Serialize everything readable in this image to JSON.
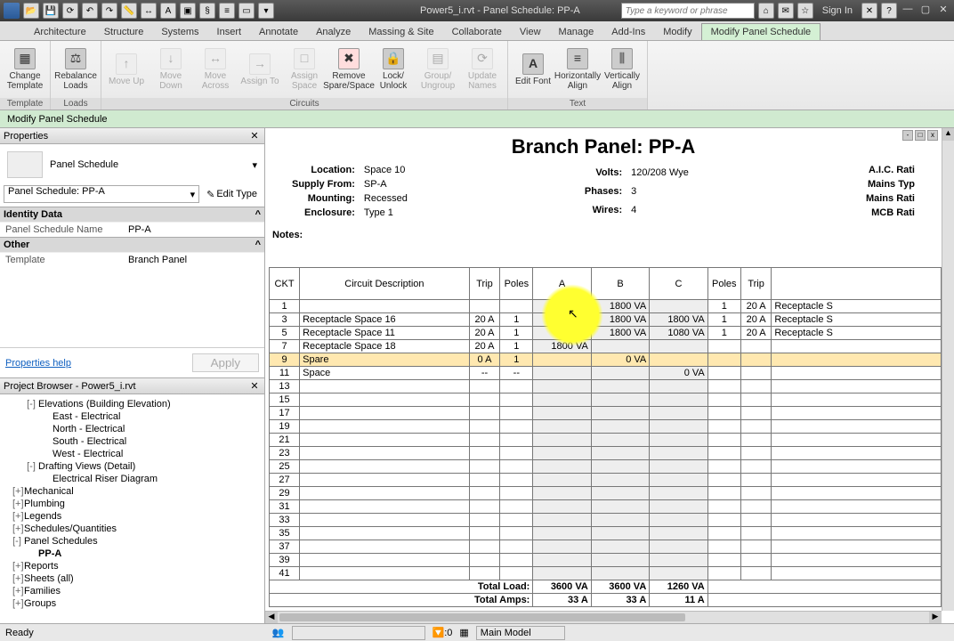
{
  "app": {
    "title": "Power5_i.rvt - Panel Schedule: PP-A",
    "search_placeholder": "Type a keyword or phrase",
    "signin": "Sign In"
  },
  "ribbon_tabs": [
    "Architecture",
    "Structure",
    "Systems",
    "Insert",
    "Annotate",
    "Analyze",
    "Massing & Site",
    "Collaborate",
    "View",
    "Manage",
    "Add-Ins",
    "Modify",
    "Modify Panel Schedule"
  ],
  "ribbon_active_tab": "Modify Panel Schedule",
  "ribbon": {
    "template_group_label": "Template",
    "loads_group_label": "Loads",
    "circuits_group_label": "Circuits",
    "text_group_label": "Text",
    "change_template": "Change Template",
    "rebalance_loads": "Rebalance Loads",
    "move_up": "Move Up",
    "move_down": "Move Down",
    "move_across": "Move Across",
    "assign_to": "Assign To",
    "assign_space": "Assign Space",
    "remove_sparespace": "Remove Spare/Space",
    "lock_unlock": "Lock/ Unlock",
    "group_ungroup": "Group/ Ungroup",
    "update_names": "Update Names",
    "edit_font": "Edit Font",
    "h_align": "Horizontally Align",
    "v_align": "Vertically Align"
  },
  "viewbar": {
    "label": "Modify Panel Schedule"
  },
  "properties": {
    "title": "Properties",
    "type_name": "Panel Schedule",
    "instance_combo": "Panel Schedule: PP-A",
    "edit_type": "Edit Type",
    "identity_data_hdr": "Identity Data",
    "panel_schedule_name_k": "Panel Schedule Name",
    "panel_schedule_name_v": "PP-A",
    "other_hdr": "Other",
    "template_k": "Template",
    "template_v": "Branch Panel",
    "help": "Properties help",
    "apply": "Apply"
  },
  "project_browser": {
    "title": "Project Browser - Power5_i.rvt",
    "nodes": [
      {
        "indent": 1,
        "exp": "-",
        "label": "Elevations (Building Elevation)"
      },
      {
        "indent": 2,
        "exp": "",
        "label": "East - Electrical"
      },
      {
        "indent": 2,
        "exp": "",
        "label": "North - Electrical"
      },
      {
        "indent": 2,
        "exp": "",
        "label": "South - Electrical"
      },
      {
        "indent": 2,
        "exp": "",
        "label": "West - Electrical"
      },
      {
        "indent": 1,
        "exp": "-",
        "label": "Drafting Views (Detail)"
      },
      {
        "indent": 2,
        "exp": "",
        "label": "Electrical Riser Diagram"
      },
      {
        "indent": 0,
        "exp": "+",
        "label": "Mechanical"
      },
      {
        "indent": 0,
        "exp": "+",
        "label": "Plumbing"
      },
      {
        "indent": 0,
        "exp": "+",
        "label": "Legends"
      },
      {
        "indent": 0,
        "exp": "+",
        "label": "Schedules/Quantities"
      },
      {
        "indent": 0,
        "exp": "-",
        "label": "Panel Schedules"
      },
      {
        "indent": 1,
        "exp": "",
        "label": "PP-A",
        "sel": true
      },
      {
        "indent": 0,
        "exp": "+",
        "label": "Reports"
      },
      {
        "indent": 0,
        "exp": "+",
        "label": "Sheets (all)"
      },
      {
        "indent": 0,
        "exp": "+",
        "label": "Families"
      },
      {
        "indent": 0,
        "exp": "+",
        "label": "Groups"
      }
    ]
  },
  "panel": {
    "title": "Branch Panel: PP-A",
    "location_k": "Location:",
    "location_v": "Space 10",
    "supply_k": "Supply From:",
    "supply_v": "SP-A",
    "mounting_k": "Mounting:",
    "mounting_v": "Recessed",
    "enclosure_k": "Enclosure:",
    "enclosure_v": "Type 1",
    "volts_k": "Volts:",
    "volts_v": "120/208 Wye",
    "phases_k": "Phases:",
    "phases_v": "3",
    "wires_k": "Wires:",
    "wires_v": "4",
    "aic_k": "A.I.C. Rati",
    "mains_type_k": "Mains Typ",
    "mains_rating_k": "Mains Rati",
    "mcb_k": "MCB Rati",
    "notes": "Notes:",
    "headers": {
      "ckt": "CKT",
      "desc": "Circuit Description",
      "trip": "Trip",
      "poles": "Poles",
      "a": "A",
      "b": "B",
      "c": "C",
      "poles2": "Poles",
      "trip2": "Trip",
      "desc2": ""
    },
    "rows": [
      {
        "ckt": "1",
        "desc": "",
        "trip": "",
        "poles": "",
        "a": "",
        "b": "1800 VA",
        "c": "",
        "poles2": "1",
        "trip2": "20 A",
        "desc2": "Receptacle S"
      },
      {
        "ckt": "3",
        "desc": "Receptacle Space 16",
        "trip": "20 A",
        "poles": "1",
        "a": "",
        "b": "1800 VA",
        "c": "1800 VA",
        "poles2": "1",
        "trip2": "20 A",
        "desc2": "Receptacle S"
      },
      {
        "ckt": "5",
        "desc": "Receptacle Space 11",
        "trip": "20 A",
        "poles": "1",
        "a": "",
        "b": "1800 VA",
        "c": "1080 VA",
        "poles2": "1",
        "trip2": "20 A",
        "desc2": "Receptacle S"
      },
      {
        "ckt": "7",
        "desc": "Receptacle Space 18",
        "trip": "20 A",
        "poles": "1",
        "a": "1800 VA",
        "b": "",
        "c": "",
        "poles2": "",
        "trip2": "",
        "desc2": ""
      },
      {
        "ckt": "9",
        "desc": "Spare",
        "trip": "0 A",
        "poles": "1",
        "a": "",
        "b": "0 VA",
        "c": "",
        "poles2": "",
        "trip2": "",
        "desc2": "",
        "sel": true
      },
      {
        "ckt": "11",
        "desc": "Space",
        "trip": "--",
        "poles": "--",
        "a": "",
        "b": "",
        "c": "0 VA",
        "poles2": "",
        "trip2": "",
        "desc2": ""
      },
      {
        "ckt": "13"
      },
      {
        "ckt": "15"
      },
      {
        "ckt": "17"
      },
      {
        "ckt": "19"
      },
      {
        "ckt": "21"
      },
      {
        "ckt": "23"
      },
      {
        "ckt": "25"
      },
      {
        "ckt": "27"
      },
      {
        "ckt": "29"
      },
      {
        "ckt": "31"
      },
      {
        "ckt": "33"
      },
      {
        "ckt": "35"
      },
      {
        "ckt": "37"
      },
      {
        "ckt": "39"
      },
      {
        "ckt": "41"
      }
    ],
    "total_load_k": "Total Load:",
    "total_amps_k": "Total Amps:",
    "total_a": "3600 VA",
    "total_b": "3600 VA",
    "total_c": "1260 VA",
    "amps_a": "33 A",
    "amps_b": "33 A",
    "amps_c": "11 A"
  },
  "status": {
    "ready": "Ready",
    "count": ":0",
    "model": "Main Model"
  }
}
